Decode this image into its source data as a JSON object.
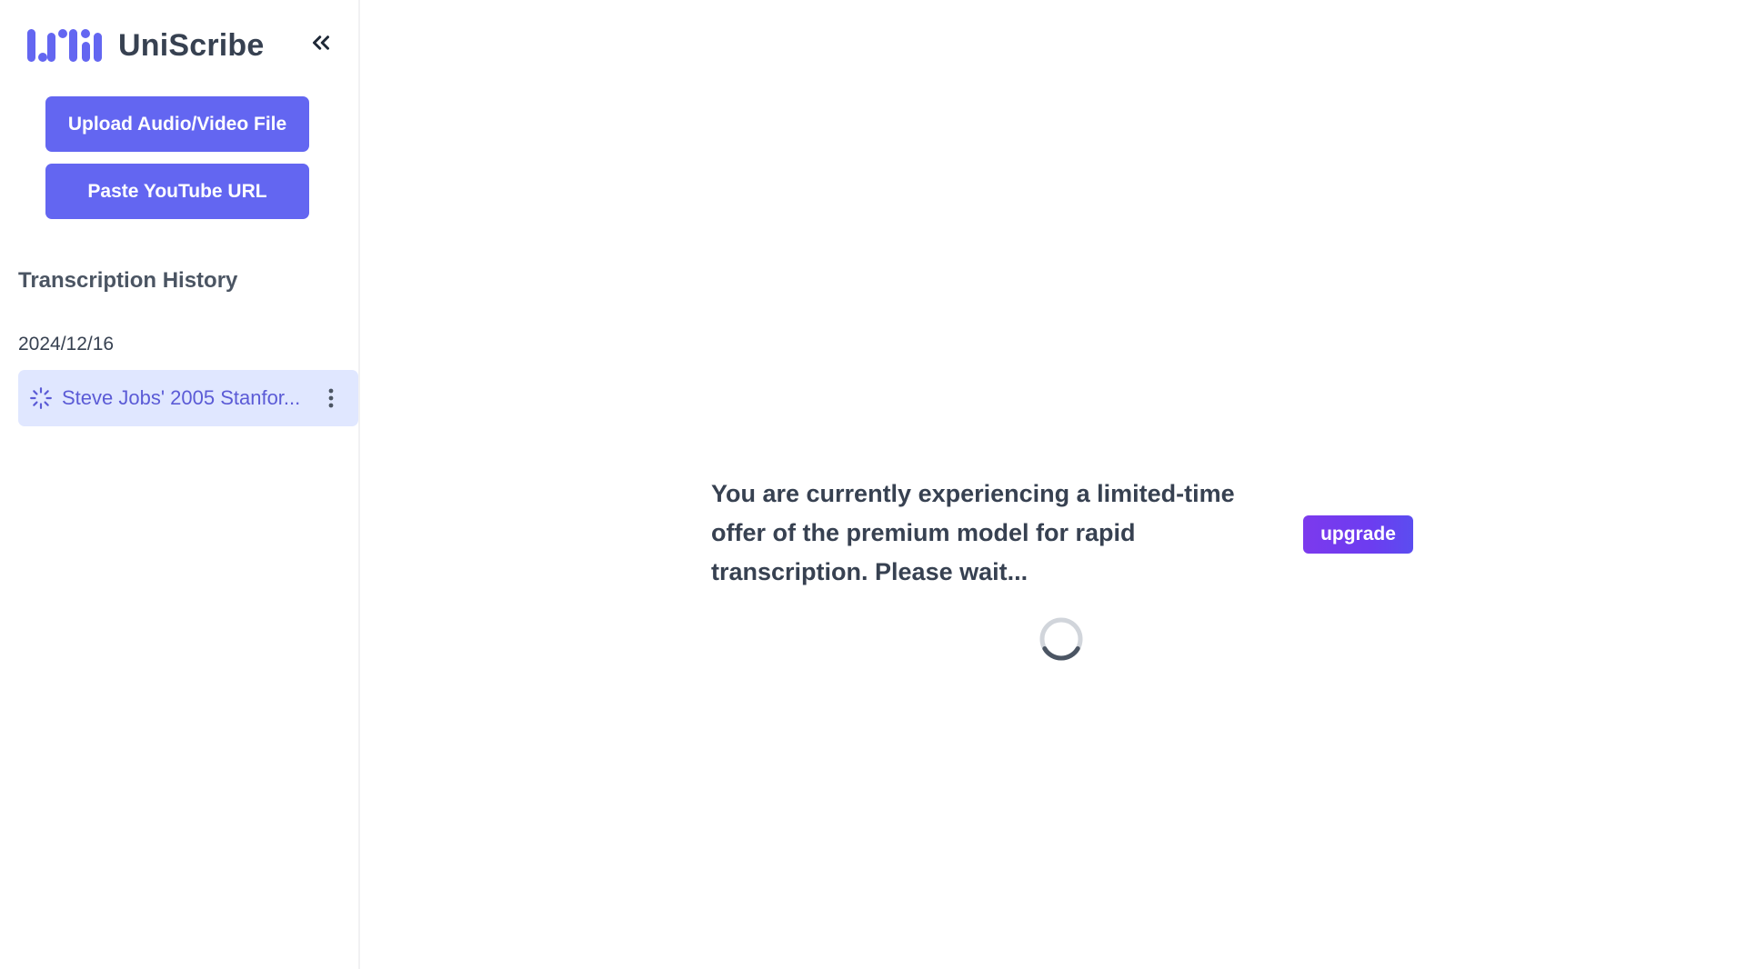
{
  "app": {
    "name": "UniScribe",
    "accent_color": "#6366f1",
    "upgrade_color": "#7c3aed"
  },
  "sidebar": {
    "collapse_icon": "chevrons-left-icon",
    "upload_button_label": "Upload Audio/Video File",
    "youtube_button_label": "Paste YouTube URL",
    "history_title": "Transcription History",
    "history_groups": [
      {
        "date": "2024/12/16",
        "items": [
          {
            "label": "Steve Jobs' 2005 Stanfor...",
            "status_icon": "loading-spinner-icon",
            "menu_icon": "kebab-menu-icon"
          }
        ]
      }
    ]
  },
  "main": {
    "notice": "You are currently experiencing a limited-time offer of the premium model for rapid transcription. Please wait...",
    "upgrade_label": "upgrade",
    "loader_icon": "loading-ring-icon"
  }
}
